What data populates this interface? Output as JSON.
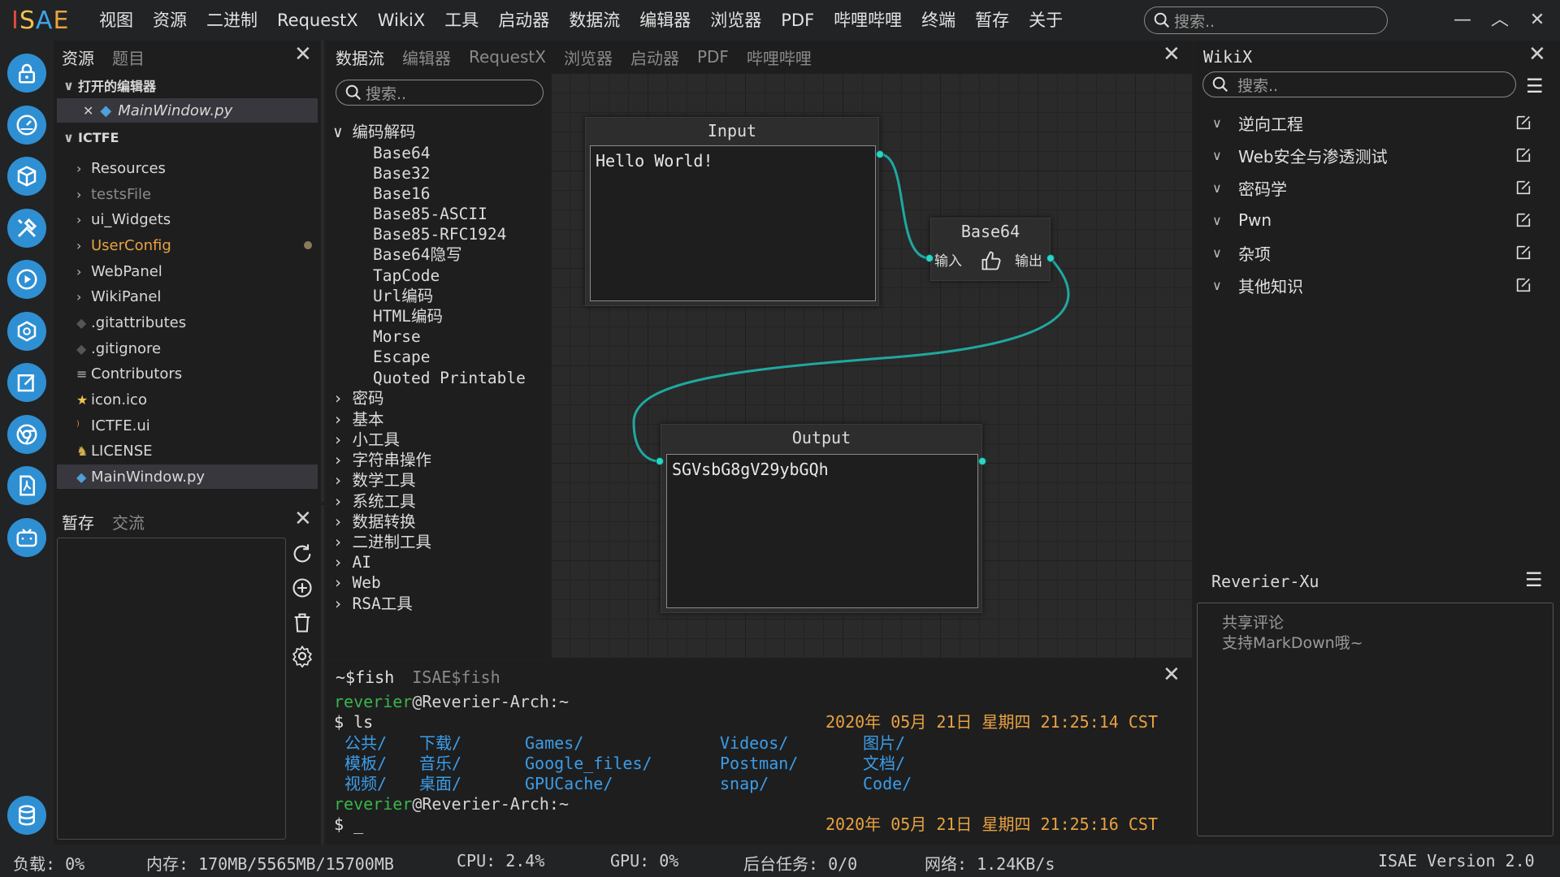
{
  "app": {
    "logo": {
      "i": "I",
      "s": "S",
      "a": "A",
      "e": "E"
    }
  },
  "menu": [
    "视图",
    "资源",
    "二进制",
    "RequestX",
    "WikiX",
    "工具",
    "启动器",
    "数据流",
    "编辑器",
    "浏览器",
    "PDF",
    "哔哩哔哩",
    "终端",
    "暂存",
    "关于"
  ],
  "top_search": {
    "placeholder": "搜索.."
  },
  "window_controls": {
    "minimize": "—",
    "maximize": "︿",
    "close": "✕"
  },
  "explorer": {
    "tabs": [
      "资源",
      "题目"
    ],
    "open_editors_label": "打开的编辑器",
    "open_file": "MainWindow.py",
    "project_label": "ICTFE",
    "items": [
      {
        "label": "Resources",
        "type": "folder"
      },
      {
        "label": "testsFile",
        "type": "folder"
      },
      {
        "label": "ui_Widgets",
        "type": "folder"
      },
      {
        "label": "UserConfig",
        "type": "folder"
      },
      {
        "label": "WebPanel",
        "type": "folder"
      },
      {
        "label": "WikiPanel",
        "type": "folder"
      },
      {
        "label": ".gitattributes",
        "type": "git"
      },
      {
        "label": ".gitignore",
        "type": "git"
      },
      {
        "label": "Contributors",
        "type": "text"
      },
      {
        "label": "icon.ico",
        "type": "star"
      },
      {
        "label": "ICTFE.ui",
        "type": "rss"
      },
      {
        "label": "LICENSE",
        "type": "license"
      },
      {
        "label": "MainWindow.py",
        "type": "python"
      }
    ]
  },
  "stash": {
    "tabs": [
      "暂存",
      "交流"
    ]
  },
  "center": {
    "tabs": [
      "数据流",
      "编辑器",
      "RequestX",
      "浏览器",
      "启动器",
      "PDF",
      "哔哩哔哩"
    ],
    "search_placeholder": "搜索..",
    "category_open": "编码解码",
    "encodings": [
      "Base64",
      "Base32",
      "Base16",
      "Base85-ASCII",
      "Base85-RFC1924",
      "Base64隐写",
      "TapCode",
      "Url编码",
      "HTML编码",
      "Morse",
      "Escape",
      "Quoted Printable"
    ],
    "categories": [
      "密码",
      "基本",
      "小工具",
      "字符串操作",
      "数学工具",
      "系统工具",
      "数据转换",
      "二进制工具",
      "AI",
      "Web",
      "RSA工具"
    ]
  },
  "flow": {
    "input_node": {
      "title": "Input",
      "text": "Hello World!"
    },
    "base64_node": {
      "title": "Base64",
      "in_label": "输入",
      "out_label": "输出"
    },
    "output_node": {
      "title": "Output",
      "text": "SGVsbG8gV29ybGQh"
    },
    "wire_color": "#1fa8a0"
  },
  "terminal": {
    "tabs": [
      "~$fish",
      "ISAE$fish"
    ],
    "user": "reverier",
    "host": "@Reverier-Arch:~",
    "cmd": "$ ls",
    "time1": "2020年 05月 21日 星期四 21:25:14 CST",
    "ls": [
      [
        "公共/",
        "下载/",
        "Games/",
        "Videos/",
        "图片/"
      ],
      [
        "模板/",
        "音乐/",
        "Google_files/",
        "Postman/",
        "文档/"
      ],
      [
        "视频/",
        "桌面/",
        "GPUCache/",
        "snap/",
        "Code/"
      ]
    ],
    "prompt2": "$ _",
    "time2": "2020年 05月 21日 星期四 21:25:16 CST"
  },
  "wikix": {
    "title": "WikiX",
    "search_placeholder": "搜索..",
    "items": [
      "逆向工程",
      "Web安全与渗透测试",
      "密码学",
      "Pwn",
      "杂项",
      "其他知识"
    ]
  },
  "comments": {
    "user": "Reverier-Xu",
    "placeholder_line1": "共享评论",
    "placeholder_line2": "支持MarkDown哦~"
  },
  "status": {
    "load": "负载: 0%",
    "mem": "内存: 170MB/5565MB/15700MB",
    "cpu": "CPU: 2.4%",
    "gpu": "GPU: 0%",
    "tasks": "后台任务: 0/0",
    "net": "网络: 1.24KB/s",
    "version": "ISAE Version 2.0"
  },
  "colors": {
    "accent": "#2f8fd3",
    "teal": "#2bd4c4",
    "orange": "#e8a23f",
    "term_green": "#39b54a",
    "term_blue": "#3b9de8"
  }
}
